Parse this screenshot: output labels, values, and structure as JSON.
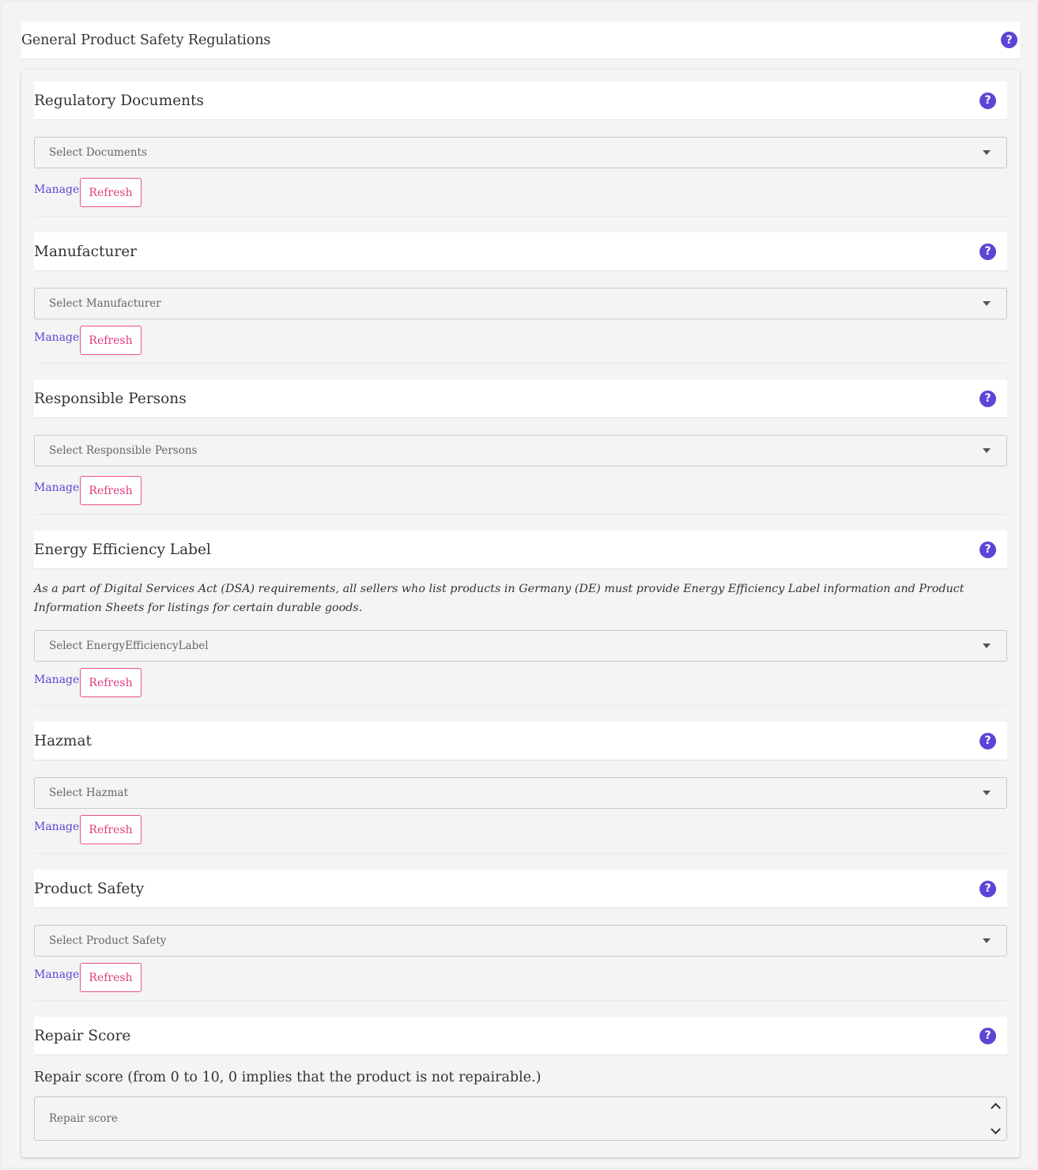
{
  "page": {
    "title": "General Product Safety Regulations",
    "help_icon": "question-circle-icon"
  },
  "colors": {
    "accent": "#5b45d6",
    "refresh_border": "#e8508a",
    "refresh_text": "#e03c7d"
  },
  "sections": {
    "regulatory": {
      "title": "Regulatory Documents",
      "select_placeholder": "Select Documents",
      "manage": "Manage",
      "refresh": "Refresh"
    },
    "manufacturer": {
      "title": "Manufacturer",
      "select_placeholder": "Select Manufacturer",
      "manage": "Manage",
      "refresh": "Refresh"
    },
    "responsible": {
      "title": "Responsible Persons",
      "select_placeholder": "Select Responsible Persons",
      "manage": "Manage",
      "refresh": "Refresh"
    },
    "energy": {
      "title": "Energy Efficiency Label",
      "description": "As a part of Digital Services Act (DSA) requirements, all sellers who list products in Germany (DE) must provide Energy Efficiency Label information and Product Information Sheets for listings for certain durable goods.",
      "select_placeholder": "Select EnergyEfficiencyLabel",
      "manage": "Manage",
      "refresh": "Refresh"
    },
    "hazmat": {
      "title": "Hazmat",
      "select_placeholder": "Select Hazmat",
      "manage": "Manage",
      "refresh": "Refresh"
    },
    "product_safety": {
      "title": "Product Safety",
      "select_placeholder": "Select Product Safety",
      "manage": "Manage",
      "refresh": "Refresh"
    },
    "repair": {
      "title": "Repair Score",
      "label": "Repair score (from 0 to 10, 0 implies that the product is not repairable.)",
      "input_placeholder": "Repair score"
    }
  }
}
